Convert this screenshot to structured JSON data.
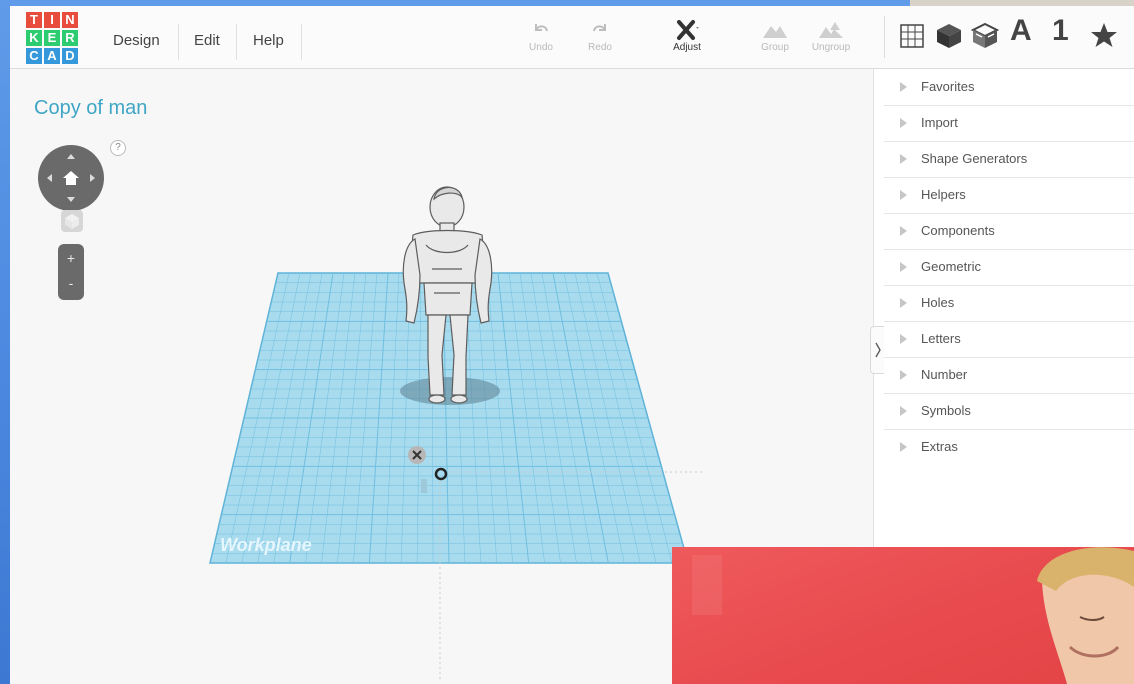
{
  "logo": {
    "letters": [
      "T",
      "I",
      "N",
      "K",
      "E",
      "R",
      "C",
      "A",
      "D"
    ]
  },
  "menu": {
    "items": [
      "Design",
      "Edit",
      "Help"
    ]
  },
  "toolbar": {
    "undo_label": "Undo",
    "redo_label": "Redo",
    "adjust_label": "Adjust",
    "group_label": "Group",
    "ungroup_label": "Ungroup"
  },
  "view_tabs": {
    "text_label": "A",
    "number_label": "1"
  },
  "document": {
    "title": "Copy of man"
  },
  "help": {
    "label": "?"
  },
  "zoom": {
    "in_label": "+",
    "out_label": "-"
  },
  "workplane": {
    "label": "Workplane"
  },
  "panel": {
    "categories": [
      "Favorites",
      "Import",
      "Shape Generators",
      "Helpers",
      "Components",
      "Geometric",
      "Holes",
      "Letters",
      "Number",
      "Symbols",
      "Extras"
    ]
  },
  "colors": {
    "title": "#40a6c5",
    "workplane_fill": "#a9dbee",
    "workplane_grid": "#6fbfe0",
    "logo_tiles": [
      "#e74c3c",
      "#e74c3c",
      "#e74c3c",
      "#2ecc71",
      "#2ecc71",
      "#2ecc71",
      "#3498db",
      "#3498db",
      "#3498db"
    ]
  }
}
